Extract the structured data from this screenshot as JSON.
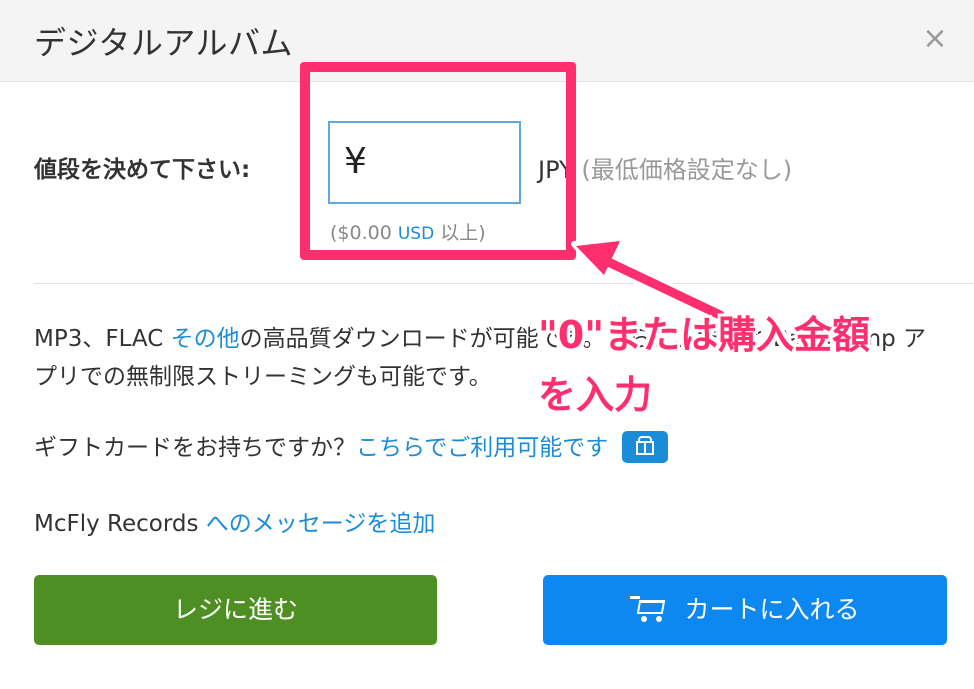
{
  "dialog": {
    "title": "デジタルアルバム",
    "close_glyph": "×"
  },
  "price": {
    "label": "値段を決めて下さい:",
    "currency_symbol": "¥",
    "input_value": "",
    "currency": "JPY",
    "currency_note": "(最低価格設定なし)",
    "min_prefix": "($0.00",
    "min_usd": "USD",
    "min_suffix": "以上)"
  },
  "description": {
    "prefix": "MP3、FLAC",
    "link": "その他",
    "text": "の高品質ダウンロードが可能です。さらに、だくと Bandcamp アプリでの無制限ストリーミングも可能です。"
  },
  "gift": {
    "question": "ギフトカードをお持ちですか？",
    "link": "こちらでご利用可能です",
    "icon": "gift-icon"
  },
  "message": {
    "artist": "McFly Records",
    "link": "へのメッセージを追加"
  },
  "buttons": {
    "checkout": "レジに進む",
    "add_to_cart": "カートに入れる"
  },
  "annotation": {
    "line1": "\"0\"または購入金額",
    "line2": "を入力",
    "color": "#ff2e6e"
  },
  "colors": {
    "link": "#1a8cd8",
    "checkout_button": "#4e8f24",
    "cart_button": "#0d88f0"
  }
}
